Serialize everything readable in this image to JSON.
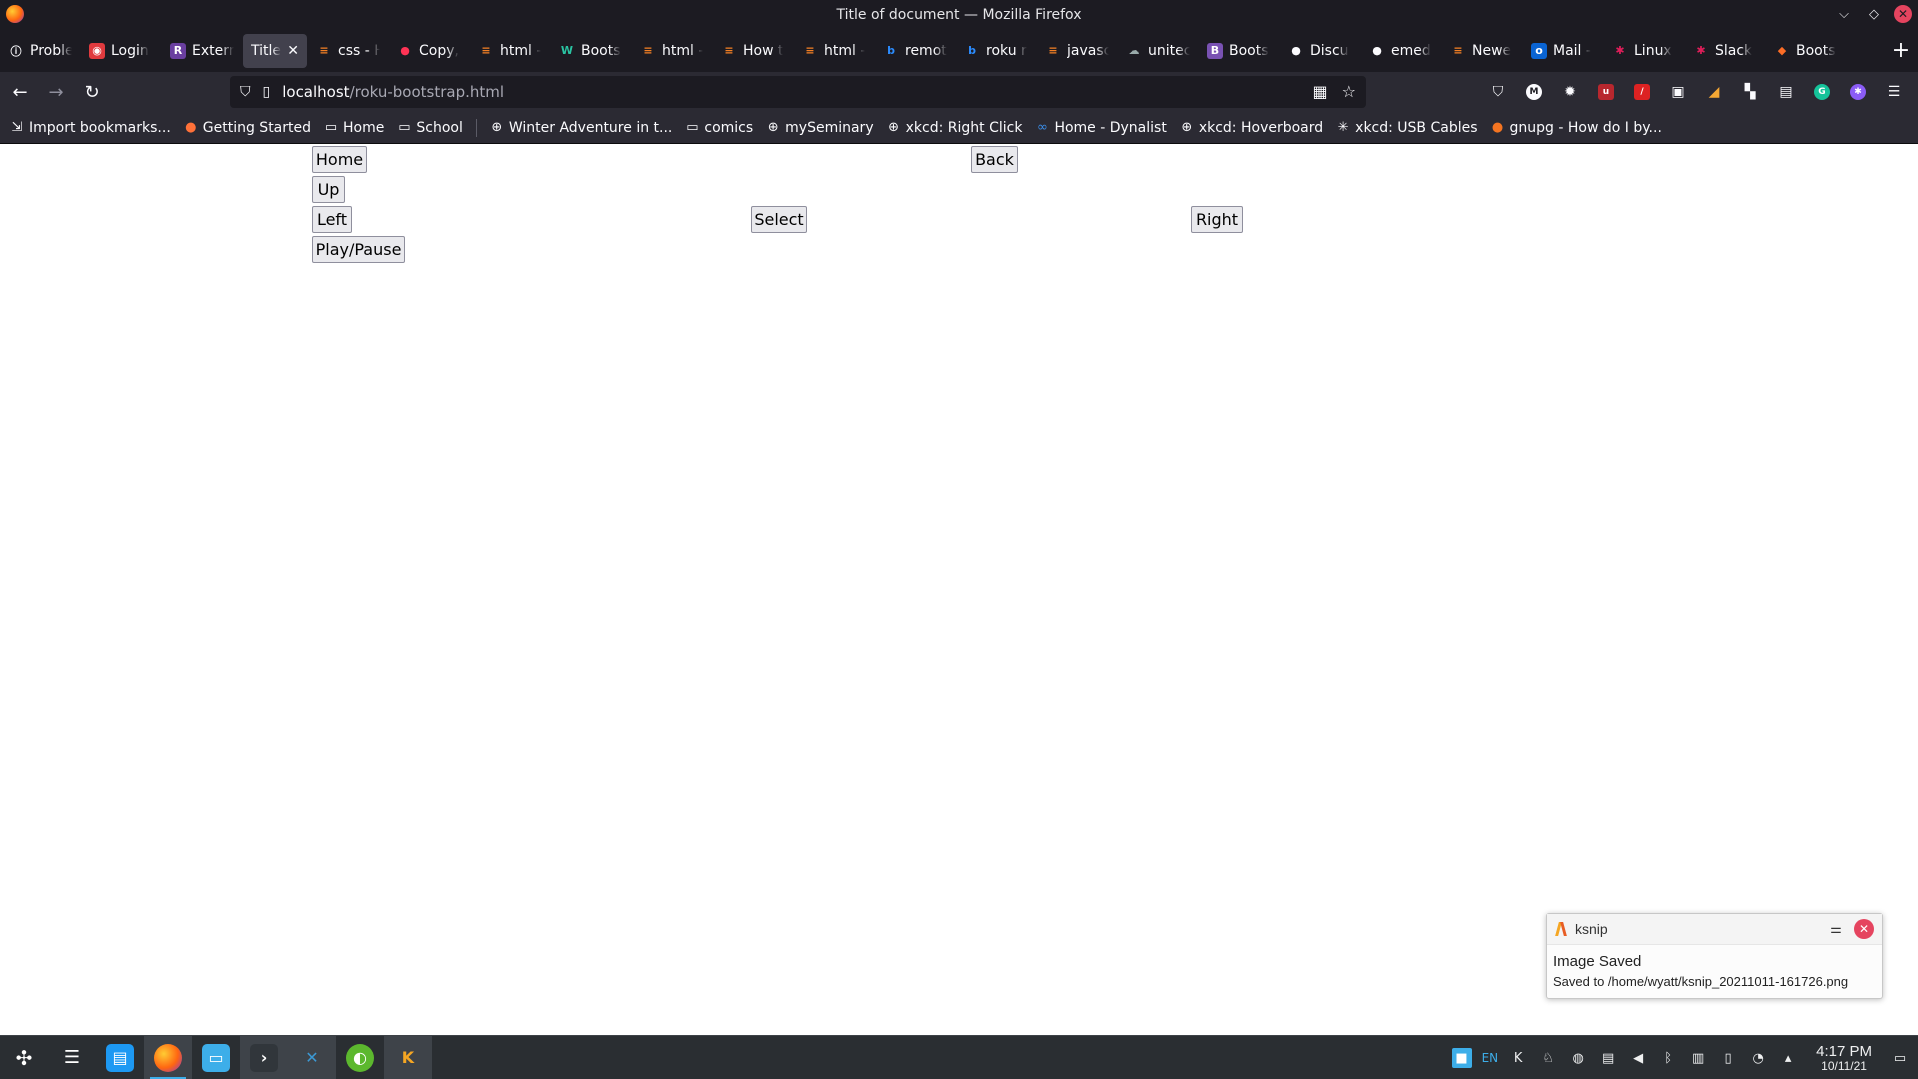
{
  "window": {
    "title": "Title of document — Mozilla Firefox",
    "minimize": "⌵",
    "maximize": "◇",
    "close": "✕"
  },
  "tabs": [
    {
      "label": "Proble",
      "favicon": "info-icon",
      "fav_char": "ⓘ",
      "fav_bg": "transparent",
      "underline": "#2ac3a2"
    },
    {
      "label": "Login",
      "favicon": "login-icon",
      "fav_char": "◉",
      "fav_bg": "#e03a3e",
      "underline": "#2ac3a2"
    },
    {
      "label": "Extern",
      "favicon": "r-icon",
      "fav_char": "R",
      "fav_bg": "#6a3fa0",
      "underline": "#2ac3a2"
    },
    {
      "label": "Title of",
      "favicon": "none",
      "fav_char": "",
      "fav_bg": "transparent",
      "underline": "",
      "active": true,
      "close": "✕"
    },
    {
      "label": "css - H",
      "favicon": "stackoverflow-icon",
      "fav_char": "≡",
      "fav_bg": "transparent",
      "underline": ""
    },
    {
      "label": "Copy,",
      "favicon": "fire-icon",
      "fav_char": "●",
      "fav_bg": "transparent",
      "underline": ""
    },
    {
      "label": "html -",
      "favicon": "stackoverflow-icon",
      "fav_char": "≡",
      "fav_bg": "transparent",
      "underline": ""
    },
    {
      "label": "Boots",
      "favicon": "w-icon",
      "fav_char": "W",
      "fav_bg": "transparent",
      "underline": ""
    },
    {
      "label": "html -",
      "favicon": "stackoverflow-icon",
      "fav_char": "≡",
      "fav_bg": "transparent",
      "underline": ""
    },
    {
      "label": "How t",
      "favicon": "stackoverflow-icon",
      "fav_char": "≡",
      "fav_bg": "transparent",
      "underline": ""
    },
    {
      "label": "html -",
      "favicon": "stackoverflow-icon",
      "fav_char": "≡",
      "fav_bg": "transparent",
      "underline": ""
    },
    {
      "label": "remot",
      "favicon": "bing-icon",
      "fav_char": "b",
      "fav_bg": "transparent",
      "underline": ""
    },
    {
      "label": "roku r",
      "favicon": "bing-icon",
      "fav_char": "b",
      "fav_bg": "transparent",
      "underline": ""
    },
    {
      "label": "javasc",
      "favicon": "stackoverflow-icon",
      "fav_char": "≡",
      "fav_bg": "transparent",
      "underline": "#ffd43b"
    },
    {
      "label": "unitec",
      "favicon": "cloud-icon",
      "fav_char": "☁",
      "fav_bg": "transparent",
      "underline": ""
    },
    {
      "label": "Boots",
      "favicon": "bootstrap-icon",
      "fav_char": "B",
      "fav_bg": "#7952b3",
      "underline": ""
    },
    {
      "label": "Discu",
      "favicon": "github-icon",
      "fav_char": "●",
      "fav_bg": "transparent",
      "underline": "#ffd43b"
    },
    {
      "label": "emed",
      "favicon": "github-icon",
      "fav_char": "●",
      "fav_bg": "transparent",
      "underline": "#ffd43b"
    },
    {
      "label": "Newe",
      "favicon": "stackoverflow-icon",
      "fav_char": "≡",
      "fav_bg": "transparent",
      "underline": ""
    },
    {
      "label": "Mail -",
      "favicon": "outlook-icon",
      "fav_char": "o",
      "fav_bg": "#0a64d3",
      "underline": ""
    },
    {
      "label": "Linux",
      "favicon": "slack-icon",
      "fav_char": "✱",
      "fav_bg": "transparent",
      "underline": ""
    },
    {
      "label": "Slack",
      "favicon": "slack-icon",
      "fav_char": "✱",
      "fav_bg": "transparent",
      "underline": ""
    },
    {
      "label": "Boots",
      "favicon": "gitlab-icon",
      "fav_char": "◆",
      "fav_bg": "transparent",
      "underline": "#ffd43b"
    }
  ],
  "newtab": "+",
  "nav": {
    "back": "←",
    "forward": "→",
    "reload": "↻",
    "url_host": "localhost",
    "url_path": "/roku-bootstrap.html"
  },
  "bookmarks": [
    {
      "label": "Import bookmarks...",
      "icon": "import-icon",
      "glyph": "⇲"
    },
    {
      "label": "Getting Started",
      "icon": "firefox-icon",
      "glyph": "●"
    },
    {
      "label": "Home",
      "icon": "folder-icon",
      "glyph": "▭"
    },
    {
      "label": "School",
      "icon": "folder-icon",
      "glyph": "▭"
    },
    {
      "label": "Winter Adventure in t...",
      "icon": "globe-icon",
      "glyph": "⊕"
    },
    {
      "label": "comics",
      "icon": "folder-icon",
      "glyph": "▭"
    },
    {
      "label": "mySeminary",
      "icon": "globe-icon",
      "glyph": "⊕"
    },
    {
      "label": "xkcd: Right Click",
      "icon": "globe-icon",
      "glyph": "⊕"
    },
    {
      "label": "Home - Dynalist",
      "icon": "dynalist-icon",
      "glyph": "∞"
    },
    {
      "label": "xkcd: Hoverboard",
      "icon": "globe-icon",
      "glyph": "⊕"
    },
    {
      "label": "xkcd: USB Cables",
      "icon": "xkcd-icon",
      "glyph": "✳"
    },
    {
      "label": "gnupg - How do I by...",
      "icon": "askubuntu-icon",
      "glyph": "●"
    }
  ],
  "page": {
    "home": "Home",
    "back": "Back",
    "up": "Up",
    "left": "Left",
    "select": "Select",
    "right": "Right",
    "play_pause": "Play/Pause"
  },
  "notification": {
    "app": "ksnip",
    "title": "Image Saved",
    "body": "Saved to /home/wyatt/ksnip_20211011-161726.png"
  },
  "taskbar": {
    "lang": "EN",
    "time": "4:17 PM",
    "date": "10/11/21"
  },
  "colors": {
    "accent": "#3daee9",
    "close_red": "#e5445f"
  }
}
